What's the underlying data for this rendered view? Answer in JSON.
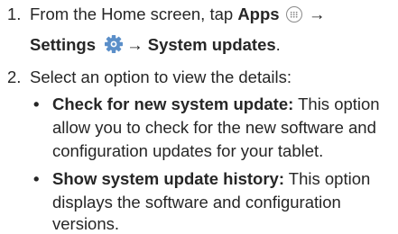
{
  "steps": [
    {
      "number": "1.",
      "line1_prefix": "From the Home screen, tap ",
      "apps_label": "Apps",
      "arrow1": "→",
      "settings_label": "Settings",
      "arrow2": "→",
      "system_updates_label": "System updates",
      "end_period": "."
    },
    {
      "number": "2.",
      "text": "Select an option to view the details:",
      "bullets": [
        {
          "marker": "•",
          "title": "Check for new system update:",
          "lines": [
            " This option",
            "allow you to check for the new software and",
            "configuration updates for your tablet."
          ]
        },
        {
          "marker": "•",
          "title": "Show system update history:",
          "lines": [
            " This option",
            "displays the software and configuration",
            "versions."
          ]
        }
      ]
    }
  ],
  "icons": {
    "apps": "apps-grid-icon",
    "settings": "gear-icon"
  },
  "colors": {
    "text": "#262626",
    "icon_gray": "#8a8a8a",
    "gear_blue": "#5b8fc9"
  }
}
